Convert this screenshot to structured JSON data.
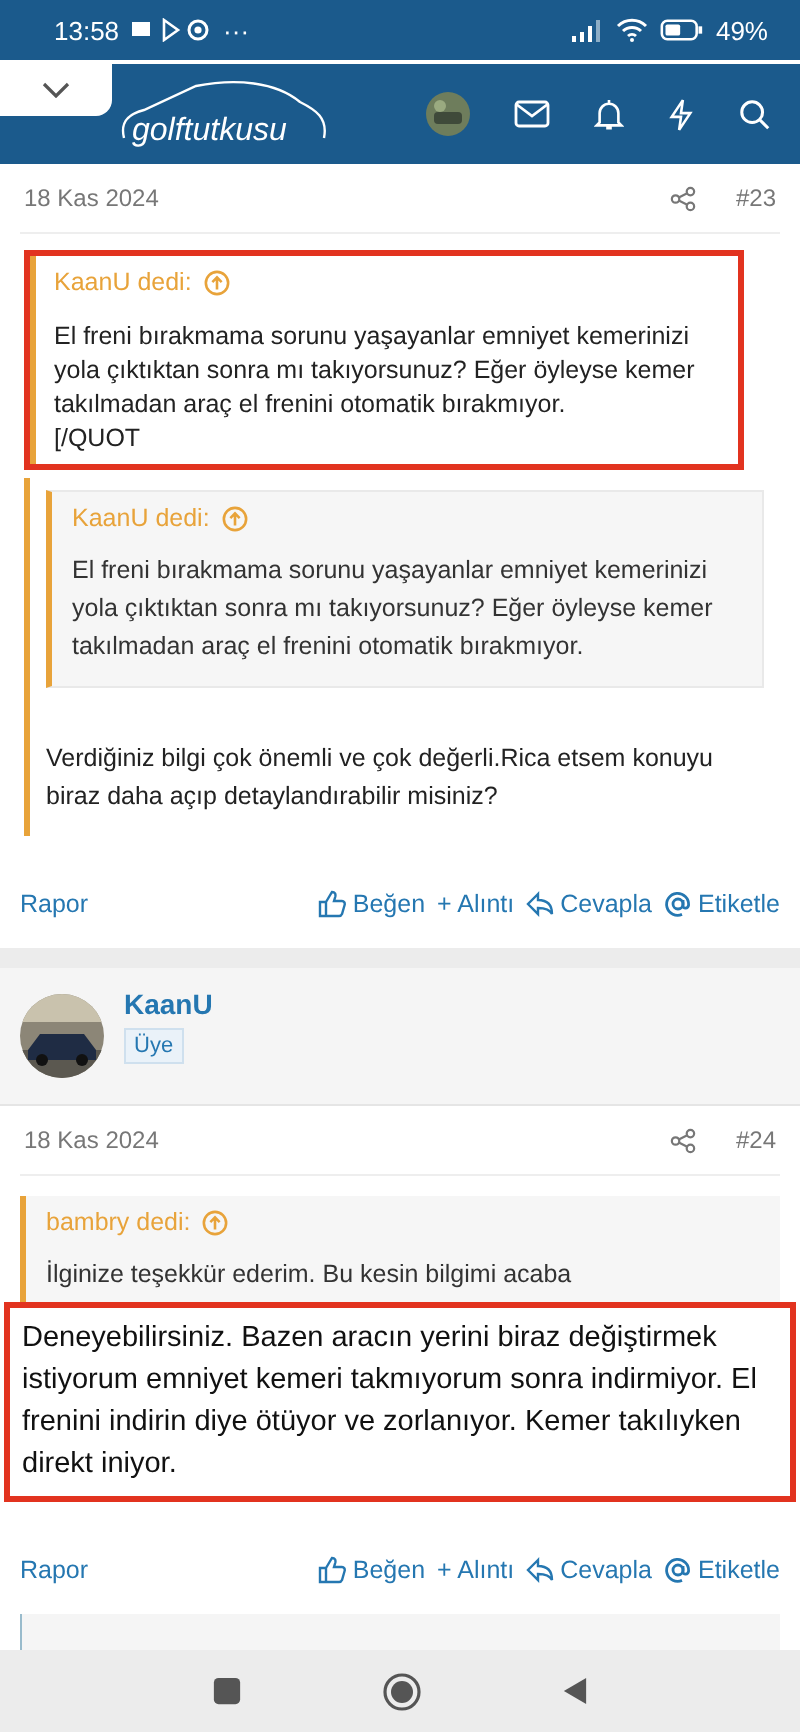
{
  "status_bar": {
    "time": "13:58",
    "more": "···",
    "battery": "49%"
  },
  "header": {
    "logo": "**golf**tutkusu"
  },
  "posts": [
    {
      "date": "18 Kas 2024",
      "number": "#23",
      "highlighted_quote": {
        "author": "KaanU dedi:",
        "text": "El freni bırakmama sorunu yaşayanlar emniyet kemerinizi yola çıktıktan sonra mı takıyorsunuz? Eğer öyleyse kemer takılmadan araç el frenini otomatik bırakmıyor.",
        "tail": "[/QUOT"
      },
      "nested_quote": {
        "author": "KaanU dedi:",
        "text": "El freni bırakmama sorunu yaşayanlar emniyet kemerinizi yola çıktıktan sonra mı takıyorsunuz? Eğer öyleyse kemer takılmadan araç el frenini otomatik bırakmıyor."
      },
      "body": "Verdiğiniz bilgi çok önemli ve çok değerli.Rica etsem konuyu biraz daha açıp detaylandırabilir misiniz?",
      "actions": [
        "Rapor",
        "Beğen",
        "+ Alıntı",
        "Cevapla",
        "Etiketle"
      ]
    },
    {
      "author": {
        "name": "KaanU",
        "role": "Üye"
      },
      "date": "18 Kas 2024",
      "number": "#24",
      "quote": {
        "author": "bambry dedi:",
        "text": "İlginize teşekkür ederim. Bu kesin bilgimi acaba"
      },
      "highlighted_body": "Deneyebilirsiniz. Bazen aracın yerini biraz değiştirmek istiyorum emniyet kemeri takmıyorum sonra indirmiyor. El frenini indirin diye ötüyor ve zorlanıyor. Kemer takılıyken direkt iniyor.",
      "actions": [
        "Rapor",
        "Beğen",
        "+ Alıntı",
        "Cevapla",
        "Etiketle"
      ]
    }
  ]
}
